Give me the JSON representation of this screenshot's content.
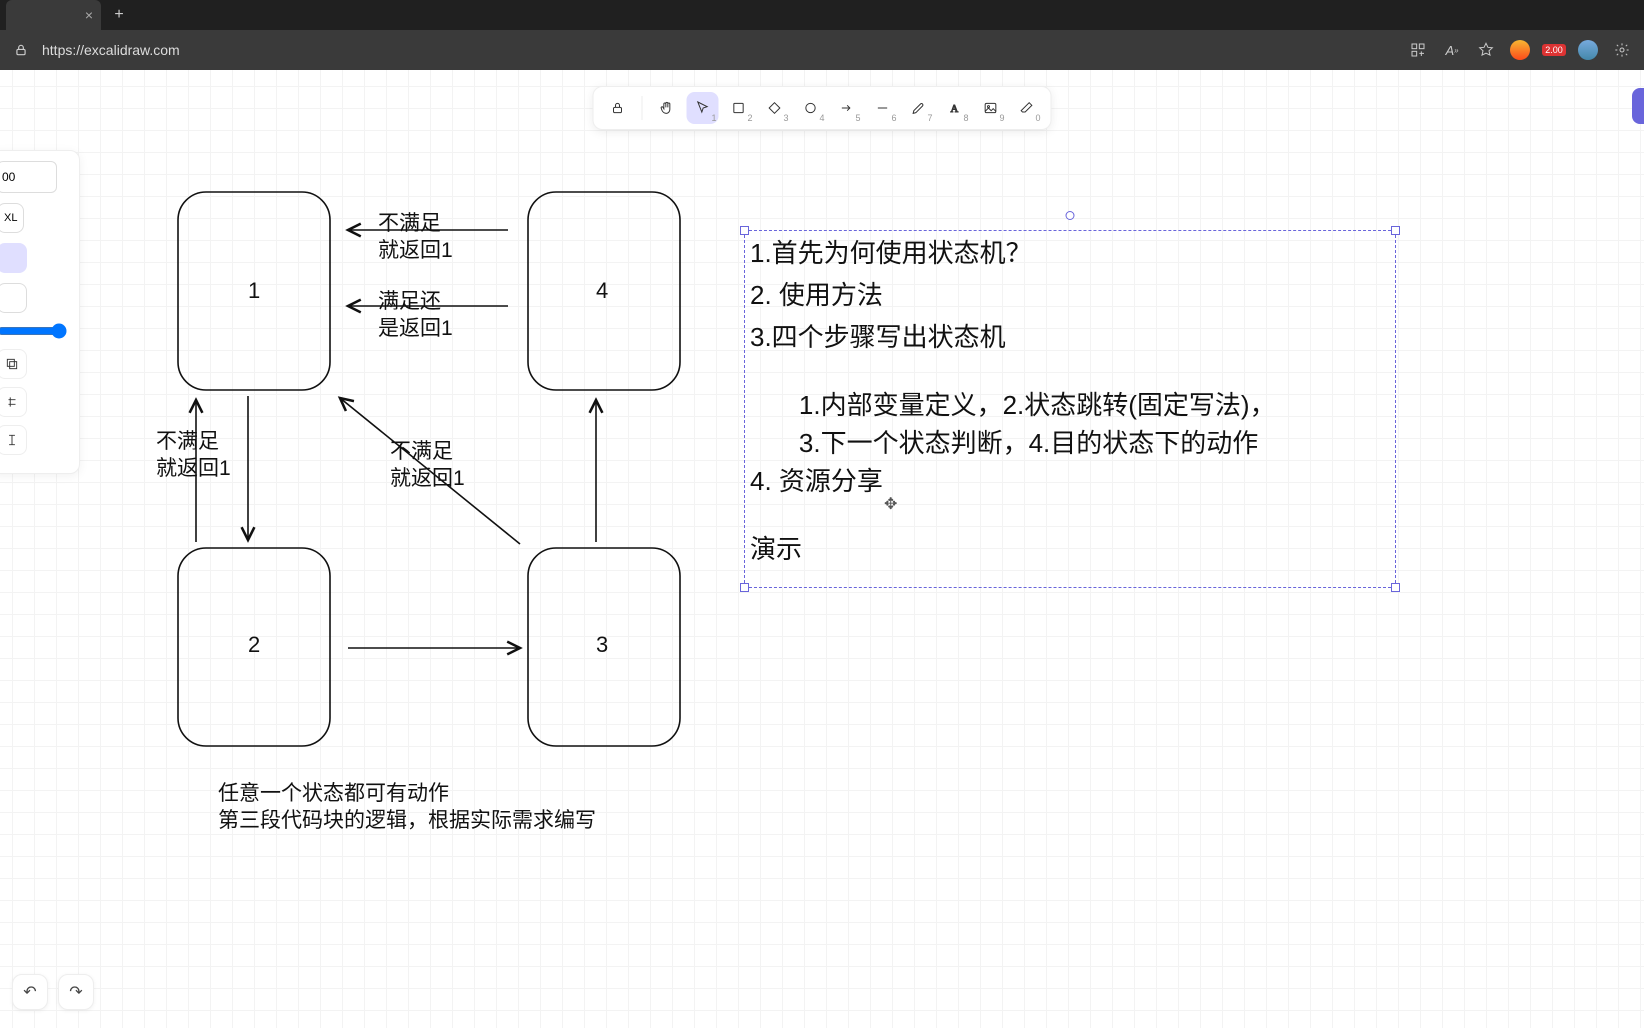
{
  "browser": {
    "url": "https://excalidraw.com",
    "new_tab": "+",
    "close": "×",
    "ext_badge": "2.00"
  },
  "toolbar": {
    "lock_key": "",
    "tools": [
      "1",
      "2",
      "3",
      "4",
      "5",
      "6",
      "7",
      "8",
      "9",
      "0"
    ]
  },
  "side_panel": {
    "input_value": "00",
    "size_label": "XL"
  },
  "share_edge_color": "#6965db",
  "diagram": {
    "nodes": {
      "n1": "1",
      "n2": "2",
      "n3": "3",
      "n4": "4"
    },
    "labels": {
      "l_top": "不满足\n就返回1",
      "l_mid": "满足还\n是返回1",
      "l_left": "不满足\n就返回1",
      "l_diag": "不满足\n就返回1"
    },
    "note": "任意一个状态都可有动作\n第三段代码块的逻辑，根据实际需求编写"
  },
  "text_block": {
    "line1": "1.首先为何使用状态机？",
    "line2": "2. 使用方法",
    "line3": "3.四个步骤写出状态机",
    "sub1": "    1.内部变量定义，2.状态跳转(固定写法)，",
    "sub2": "    3.下一个状态判断，4.目的状态下的动作",
    "line4": "4. 资源分享",
    "line5": "演示"
  }
}
